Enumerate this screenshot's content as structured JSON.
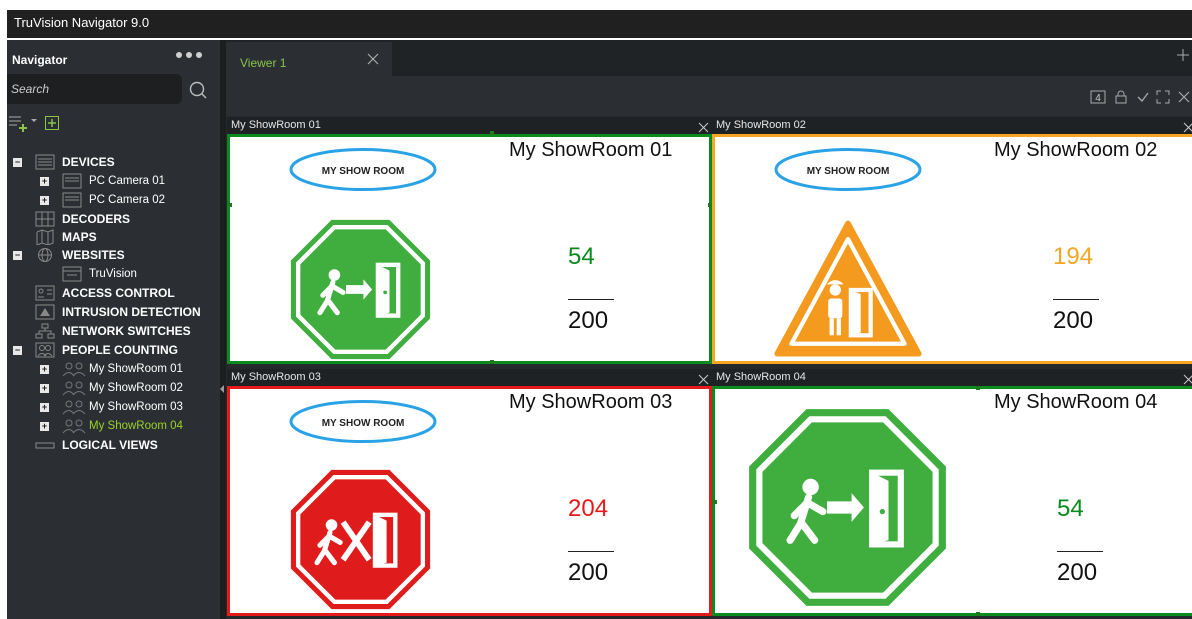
{
  "app": {
    "title": "TruVision Navigator 9.0"
  },
  "navigator": {
    "title": "Navigator",
    "more_icon": "ellipsis-icon",
    "search": {
      "placeholder": "Search",
      "value": ""
    },
    "tree": [
      {
        "label": "DEVICES",
        "bold": true,
        "expanded": true
      },
      {
        "label": "PC Camera 01"
      },
      {
        "label": "PC Camera 02"
      },
      {
        "label": "DECODERS",
        "bold": true
      },
      {
        "label": "MAPS",
        "bold": true
      },
      {
        "label": "WEBSITES",
        "bold": true,
        "expanded": true
      },
      {
        "label": "TruVision"
      },
      {
        "label": "ACCESS CONTROL",
        "bold": true
      },
      {
        "label": "INTRUSION DETECTION",
        "bold": true
      },
      {
        "label": "NETWORK SWITCHES",
        "bold": true
      },
      {
        "label": "PEOPLE COUNTING",
        "bold": true,
        "expanded": true
      },
      {
        "label": "My ShowRoom 01"
      },
      {
        "label": "My ShowRoom 02"
      },
      {
        "label": "My ShowRoom 03"
      },
      {
        "label": "My ShowRoom 04",
        "selected": true
      },
      {
        "label": "LOGICAL VIEWS",
        "bold": true
      }
    ]
  },
  "viewer": {
    "tab_label": "Viewer 1",
    "layout_number": "4",
    "tiles": [
      {
        "header": "My ShowRoom 01",
        "name": "My ShowRoom 01",
        "logo": "MY SHOW ROOM",
        "count": "54",
        "capacity": "200",
        "status": "ok",
        "status_color": "#0b8a1e",
        "sign_icon": "exit-allowed-sign-icon"
      },
      {
        "header": "My ShowRoom 02",
        "name": "My ShowRoom 02",
        "logo": "MY SHOW ROOM",
        "count": "194",
        "capacity": "200",
        "status": "warning",
        "status_color": "#f5a623",
        "sign_icon": "wait-warning-sign-icon"
      },
      {
        "header": "My ShowRoom 03",
        "name": "My ShowRoom 03",
        "logo": "MY SHOW ROOM",
        "count": "204",
        "capacity": "200",
        "status": "full",
        "status_color": "#e51a1a",
        "sign_icon": "no-entry-sign-icon"
      },
      {
        "header": "My ShowRoom 04",
        "name": "My ShowRoom 04",
        "logo": "",
        "count": "54",
        "capacity": "200",
        "status": "ok",
        "status_color": "#0b8a1e",
        "sign_icon": "exit-allowed-sign-icon"
      }
    ]
  },
  "colors": {
    "accent_green": "#8bc34a",
    "sign_green": "#3fae3f",
    "sign_orange": "#f39a1f",
    "sign_red": "#e01b1b",
    "logo_blue": "#2aa3e6"
  }
}
